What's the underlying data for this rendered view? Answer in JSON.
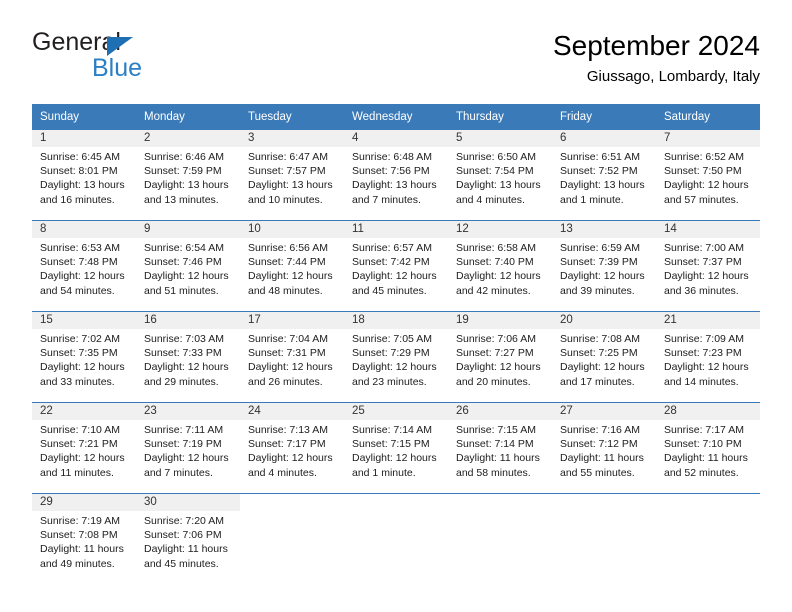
{
  "brand": {
    "name_top": "General",
    "name_bottom": "Blue"
  },
  "header": {
    "title": "September 2024",
    "subtitle": "Giussago, Lombardy, Italy"
  },
  "theme": {
    "header_blue": "#3a7ab8",
    "brand_blue": "#2b7fc4",
    "daynum_band": "#f0f0f0"
  },
  "weekdays": [
    "Sunday",
    "Monday",
    "Tuesday",
    "Wednesday",
    "Thursday",
    "Friday",
    "Saturday"
  ],
  "weeks": [
    [
      {
        "day": "1",
        "sunrise": "Sunrise: 6:45 AM",
        "sunset": "Sunset: 8:01 PM",
        "daylight_1": "Daylight: 13 hours",
        "daylight_2": "and 16 minutes."
      },
      {
        "day": "2",
        "sunrise": "Sunrise: 6:46 AM",
        "sunset": "Sunset: 7:59 PM",
        "daylight_1": "Daylight: 13 hours",
        "daylight_2": "and 13 minutes."
      },
      {
        "day": "3",
        "sunrise": "Sunrise: 6:47 AM",
        "sunset": "Sunset: 7:57 PM",
        "daylight_1": "Daylight: 13 hours",
        "daylight_2": "and 10 minutes."
      },
      {
        "day": "4",
        "sunrise": "Sunrise: 6:48 AM",
        "sunset": "Sunset: 7:56 PM",
        "daylight_1": "Daylight: 13 hours",
        "daylight_2": "and 7 minutes."
      },
      {
        "day": "5",
        "sunrise": "Sunrise: 6:50 AM",
        "sunset": "Sunset: 7:54 PM",
        "daylight_1": "Daylight: 13 hours",
        "daylight_2": "and 4 minutes."
      },
      {
        "day": "6",
        "sunrise": "Sunrise: 6:51 AM",
        "sunset": "Sunset: 7:52 PM",
        "daylight_1": "Daylight: 13 hours",
        "daylight_2": "and 1 minute."
      },
      {
        "day": "7",
        "sunrise": "Sunrise: 6:52 AM",
        "sunset": "Sunset: 7:50 PM",
        "daylight_1": "Daylight: 12 hours",
        "daylight_2": "and 57 minutes."
      }
    ],
    [
      {
        "day": "8",
        "sunrise": "Sunrise: 6:53 AM",
        "sunset": "Sunset: 7:48 PM",
        "daylight_1": "Daylight: 12 hours",
        "daylight_2": "and 54 minutes."
      },
      {
        "day": "9",
        "sunrise": "Sunrise: 6:54 AM",
        "sunset": "Sunset: 7:46 PM",
        "daylight_1": "Daylight: 12 hours",
        "daylight_2": "and 51 minutes."
      },
      {
        "day": "10",
        "sunrise": "Sunrise: 6:56 AM",
        "sunset": "Sunset: 7:44 PM",
        "daylight_1": "Daylight: 12 hours",
        "daylight_2": "and 48 minutes."
      },
      {
        "day": "11",
        "sunrise": "Sunrise: 6:57 AM",
        "sunset": "Sunset: 7:42 PM",
        "daylight_1": "Daylight: 12 hours",
        "daylight_2": "and 45 minutes."
      },
      {
        "day": "12",
        "sunrise": "Sunrise: 6:58 AM",
        "sunset": "Sunset: 7:40 PM",
        "daylight_1": "Daylight: 12 hours",
        "daylight_2": "and 42 minutes."
      },
      {
        "day": "13",
        "sunrise": "Sunrise: 6:59 AM",
        "sunset": "Sunset: 7:39 PM",
        "daylight_1": "Daylight: 12 hours",
        "daylight_2": "and 39 minutes."
      },
      {
        "day": "14",
        "sunrise": "Sunrise: 7:00 AM",
        "sunset": "Sunset: 7:37 PM",
        "daylight_1": "Daylight: 12 hours",
        "daylight_2": "and 36 minutes."
      }
    ],
    [
      {
        "day": "15",
        "sunrise": "Sunrise: 7:02 AM",
        "sunset": "Sunset: 7:35 PM",
        "daylight_1": "Daylight: 12 hours",
        "daylight_2": "and 33 minutes."
      },
      {
        "day": "16",
        "sunrise": "Sunrise: 7:03 AM",
        "sunset": "Sunset: 7:33 PM",
        "daylight_1": "Daylight: 12 hours",
        "daylight_2": "and 29 minutes."
      },
      {
        "day": "17",
        "sunrise": "Sunrise: 7:04 AM",
        "sunset": "Sunset: 7:31 PM",
        "daylight_1": "Daylight: 12 hours",
        "daylight_2": "and 26 minutes."
      },
      {
        "day": "18",
        "sunrise": "Sunrise: 7:05 AM",
        "sunset": "Sunset: 7:29 PM",
        "daylight_1": "Daylight: 12 hours",
        "daylight_2": "and 23 minutes."
      },
      {
        "day": "19",
        "sunrise": "Sunrise: 7:06 AM",
        "sunset": "Sunset: 7:27 PM",
        "daylight_1": "Daylight: 12 hours",
        "daylight_2": "and 20 minutes."
      },
      {
        "day": "20",
        "sunrise": "Sunrise: 7:08 AM",
        "sunset": "Sunset: 7:25 PM",
        "daylight_1": "Daylight: 12 hours",
        "daylight_2": "and 17 minutes."
      },
      {
        "day": "21",
        "sunrise": "Sunrise: 7:09 AM",
        "sunset": "Sunset: 7:23 PM",
        "daylight_1": "Daylight: 12 hours",
        "daylight_2": "and 14 minutes."
      }
    ],
    [
      {
        "day": "22",
        "sunrise": "Sunrise: 7:10 AM",
        "sunset": "Sunset: 7:21 PM",
        "daylight_1": "Daylight: 12 hours",
        "daylight_2": "and 11 minutes."
      },
      {
        "day": "23",
        "sunrise": "Sunrise: 7:11 AM",
        "sunset": "Sunset: 7:19 PM",
        "daylight_1": "Daylight: 12 hours",
        "daylight_2": "and 7 minutes."
      },
      {
        "day": "24",
        "sunrise": "Sunrise: 7:13 AM",
        "sunset": "Sunset: 7:17 PM",
        "daylight_1": "Daylight: 12 hours",
        "daylight_2": "and 4 minutes."
      },
      {
        "day": "25",
        "sunrise": "Sunrise: 7:14 AM",
        "sunset": "Sunset: 7:15 PM",
        "daylight_1": "Daylight: 12 hours",
        "daylight_2": "and 1 minute."
      },
      {
        "day": "26",
        "sunrise": "Sunrise: 7:15 AM",
        "sunset": "Sunset: 7:14 PM",
        "daylight_1": "Daylight: 11 hours",
        "daylight_2": "and 58 minutes."
      },
      {
        "day": "27",
        "sunrise": "Sunrise: 7:16 AM",
        "sunset": "Sunset: 7:12 PM",
        "daylight_1": "Daylight: 11 hours",
        "daylight_2": "and 55 minutes."
      },
      {
        "day": "28",
        "sunrise": "Sunrise: 7:17 AM",
        "sunset": "Sunset: 7:10 PM",
        "daylight_1": "Daylight: 11 hours",
        "daylight_2": "and 52 minutes."
      }
    ],
    [
      {
        "day": "29",
        "sunrise": "Sunrise: 7:19 AM",
        "sunset": "Sunset: 7:08 PM",
        "daylight_1": "Daylight: 11 hours",
        "daylight_2": "and 49 minutes."
      },
      {
        "day": "30",
        "sunrise": "Sunrise: 7:20 AM",
        "sunset": "Sunset: 7:06 PM",
        "daylight_1": "Daylight: 11 hours",
        "daylight_2": "and 45 minutes."
      },
      {
        "day": "",
        "sunrise": "",
        "sunset": "",
        "daylight_1": "",
        "daylight_2": ""
      },
      {
        "day": "",
        "sunrise": "",
        "sunset": "",
        "daylight_1": "",
        "daylight_2": ""
      },
      {
        "day": "",
        "sunrise": "",
        "sunset": "",
        "daylight_1": "",
        "daylight_2": ""
      },
      {
        "day": "",
        "sunrise": "",
        "sunset": "",
        "daylight_1": "",
        "daylight_2": ""
      },
      {
        "day": "",
        "sunrise": "",
        "sunset": "",
        "daylight_1": "",
        "daylight_2": ""
      }
    ]
  ]
}
